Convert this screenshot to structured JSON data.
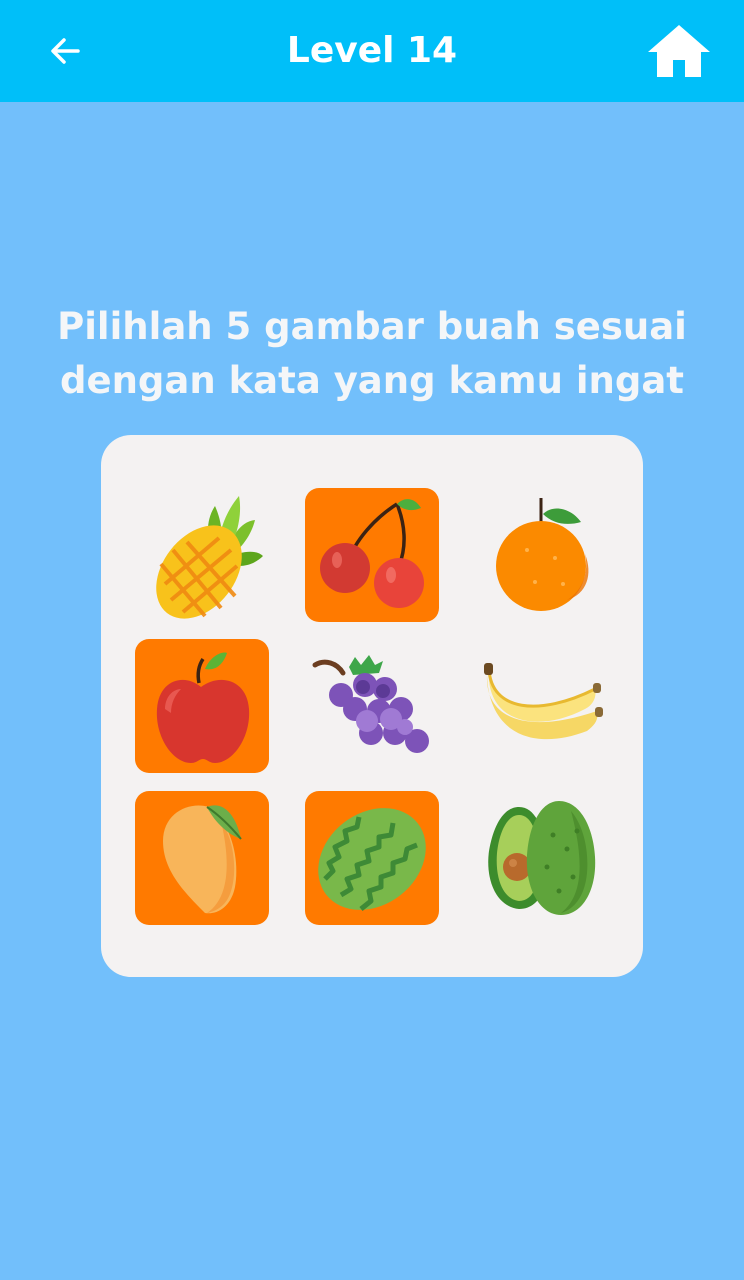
{
  "header": {
    "title": "Level 14",
    "back_icon": "arrow-left-icon",
    "home_icon": "home-icon",
    "background": "#00bff9"
  },
  "instruction": {
    "line1": "Pilihlah 5 gambar buah sesuai",
    "line2": "dengan kata yang kamu ingat"
  },
  "board": {
    "selected_color": "#ff7a00",
    "tiles": [
      {
        "fruit": "pineapple-icon",
        "selected": false
      },
      {
        "fruit": "cherry-icon",
        "selected": true
      },
      {
        "fruit": "orange-icon",
        "selected": false
      },
      {
        "fruit": "apple-icon",
        "selected": true
      },
      {
        "fruit": "grapes-icon",
        "selected": false
      },
      {
        "fruit": "banana-icon",
        "selected": false
      },
      {
        "fruit": "mango-icon",
        "selected": true
      },
      {
        "fruit": "watermelon-icon",
        "selected": true
      },
      {
        "fruit": "avocado-icon",
        "selected": false
      }
    ]
  },
  "colors": {
    "page_background": "#72bffb",
    "board_background": "#f4f2f2"
  }
}
